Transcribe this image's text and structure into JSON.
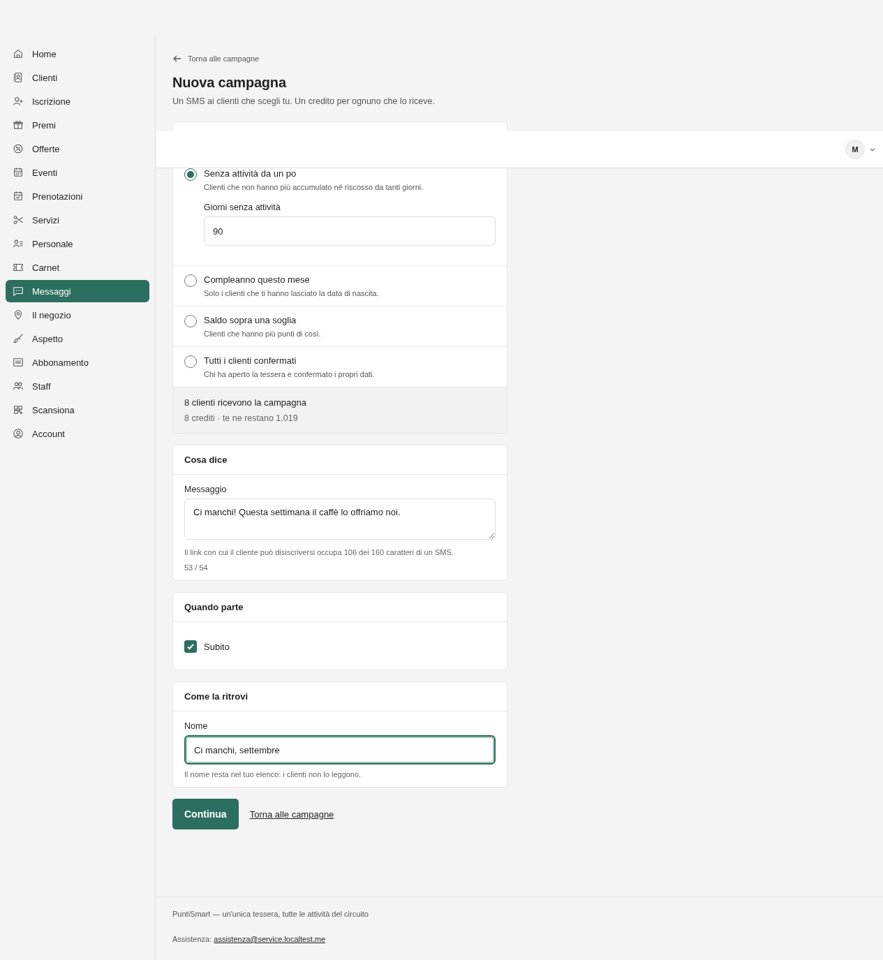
{
  "sidebar": {
    "items": [
      {
        "label": "Home",
        "selected": false
      },
      {
        "label": "Clienti",
        "selected": false
      },
      {
        "label": "Iscrizione",
        "selected": false
      },
      {
        "label": "Premi",
        "selected": false
      },
      {
        "label": "Offerte",
        "selected": false
      },
      {
        "label": "Eventi",
        "selected": false
      },
      {
        "label": "Prenotazioni",
        "selected": false
      },
      {
        "label": "Servizi",
        "selected": false
      },
      {
        "label": "Personale",
        "selected": false
      },
      {
        "label": "Carnet",
        "selected": false
      },
      {
        "label": "Messaggi",
        "selected": true
      },
      {
        "label": "Il negozio",
        "selected": false
      },
      {
        "label": "Aspetto",
        "selected": false
      },
      {
        "label": "Abbonamento",
        "selected": false
      },
      {
        "label": "Staff",
        "selected": false
      },
      {
        "label": "Scansiona",
        "selected": false
      },
      {
        "label": "Account",
        "selected": false
      }
    ]
  },
  "header": {
    "avatar": "M"
  },
  "back_link": "Torna alle campagne",
  "title": "Nuova campagna",
  "subtitle": "Un SMS ai clienti che scegli tu. Un credito per ognuno che lo riceve.",
  "audience": {
    "options": [
      {
        "label": "Senza attività da un po",
        "description": "Clienti che non hanno più accumulato né riscosso da tanti giorni.",
        "selected": true,
        "field": {
          "label": "Giorni senza attività",
          "value": "90"
        }
      },
      {
        "label": "Compleanno questo mese",
        "description": "Solo i clienti che ti hanno lasciato la data di nascita.",
        "selected": false
      },
      {
        "label": "Saldo sopra una soglia",
        "description": "Clienti che hanno più punti di così.",
        "selected": false
      },
      {
        "label": "Tutti i clienti confermati",
        "description": "Chi ha aperto la tessera e confermato i propri dati.",
        "selected": false
      }
    ],
    "summary": "8 clienti ricevono la campagna",
    "credits": "8 crediti · te ne restano 1.019"
  },
  "message": {
    "title": "Cosa dice",
    "label": "Messaggio",
    "value": "Ci manchi! Questa settimana il caffè lo offriamo noi.",
    "help": "Il link con cui il cliente può disiscriversi occupa 106 dei 160 caratteri di un SMS.",
    "counter": "53 / 54"
  },
  "timing": {
    "title": "Quando parte",
    "checkbox": {
      "label": "Subito",
      "checked": true
    }
  },
  "naming": {
    "title": "Come la ritrovi",
    "label": "Nome",
    "value": "Ci manchi, settembre",
    "help": "Il nome resta nel tuo elenco: i clienti non lo leggono.",
    "focused": true
  },
  "actions": {
    "primary": "Continua",
    "secondary": "Torna alle campagne"
  },
  "footer": {
    "tagline": "PuntiSmart — un'unica tessera, tutte le attività del circuito",
    "support_label": "Assistenza:",
    "support_email": "assistenza@service.localtest.me"
  }
}
